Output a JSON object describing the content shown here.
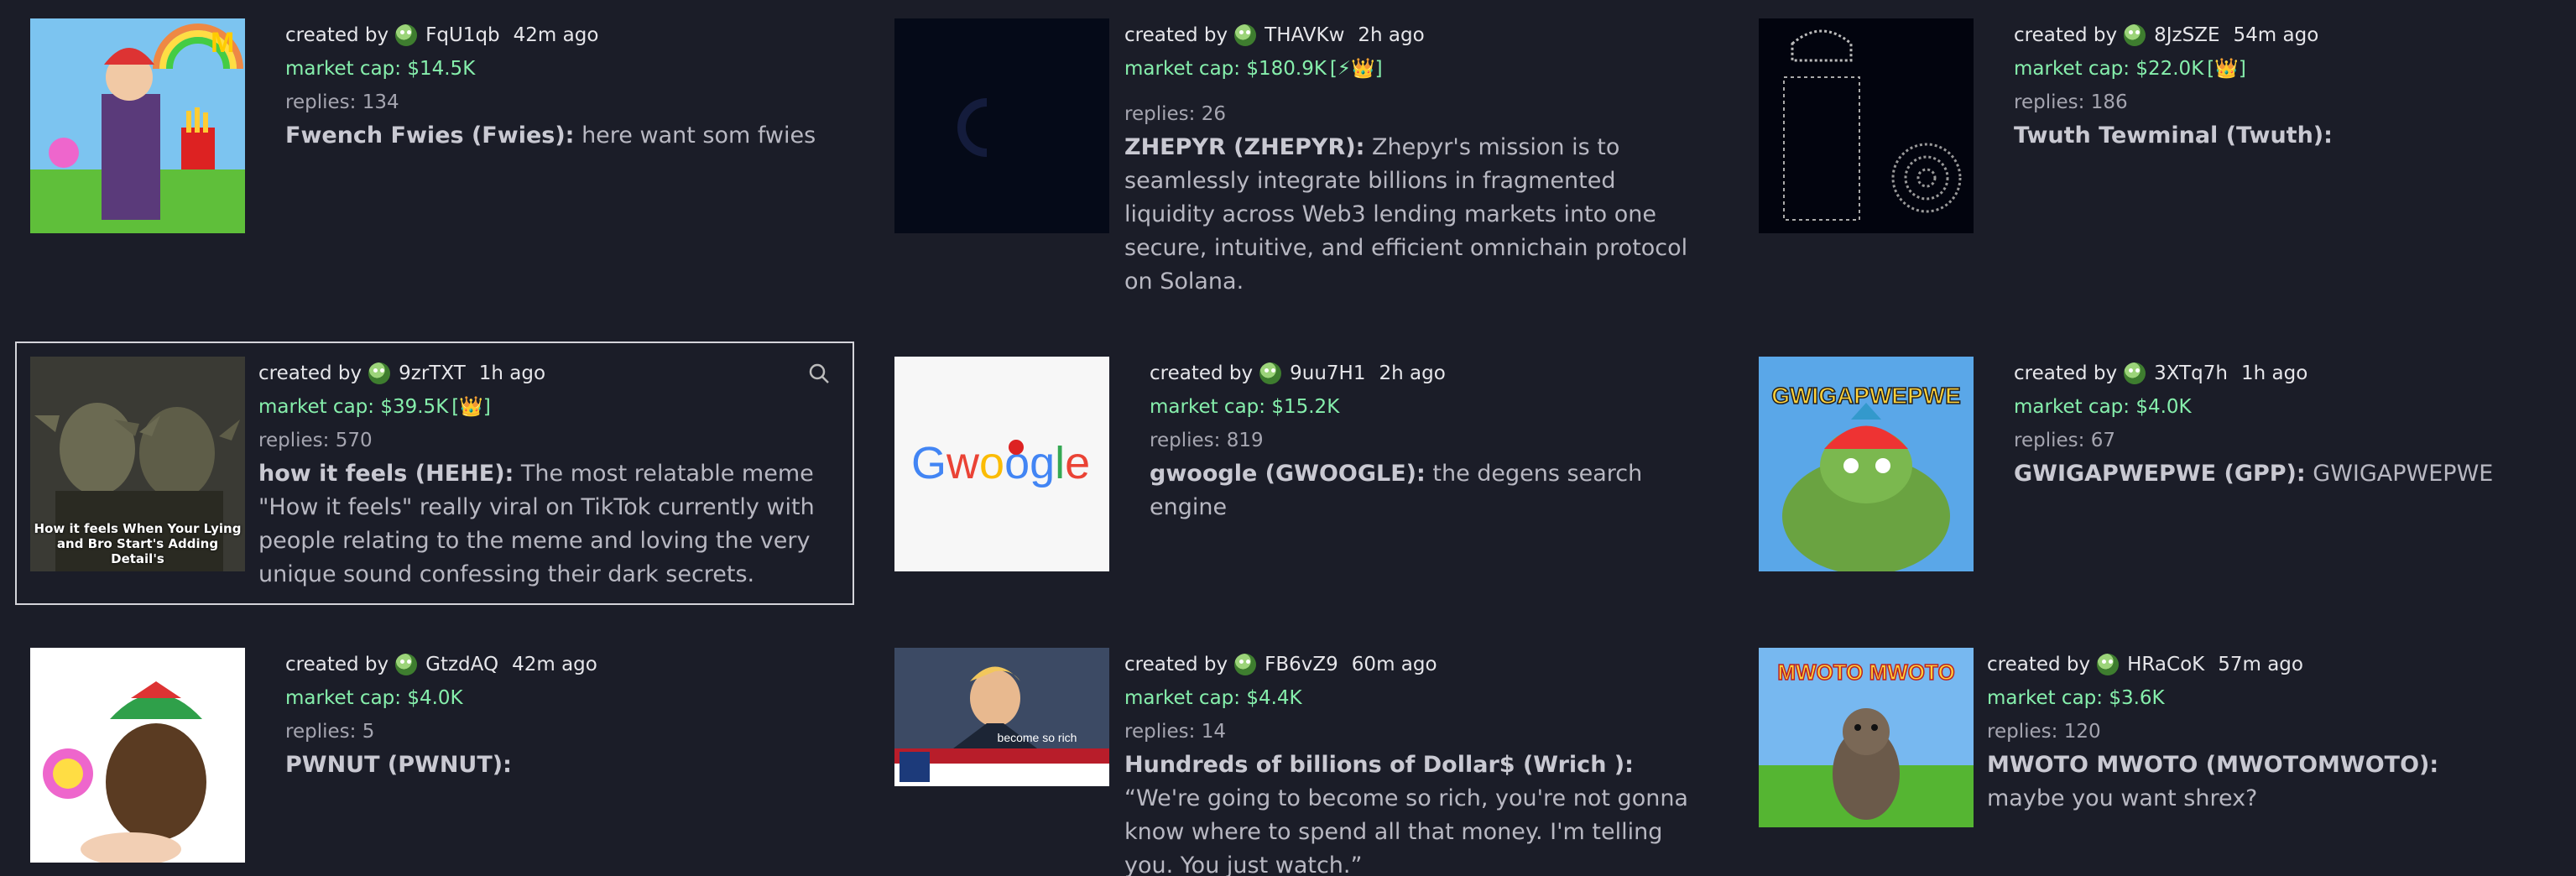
{
  "created_by_label": "created by",
  "market_cap_label": "market cap:",
  "replies_label": "replies:",
  "cards": [
    {
      "user": "FqU1qb",
      "time": "42m ago",
      "mcap": "$14.5K",
      "badge": "",
      "replies": "134",
      "name": "Fwench Fwies (Fwies):",
      "desc": " here want som fwies",
      "image": "fries-character-icon"
    },
    {
      "user": "THAVKw",
      "time": "2h ago",
      "mcap": "$180.9K",
      "badge": "[⚡👑]",
      "replies": "26",
      "name": "ZHEPYR (ZHEPYR):",
      "desc": " Zhepyr's mission is to seamlessly integrate billions in fragmented liquidity across Web3 lending markets into one secure, intuitive, and efficient omnichain protocol on Solana.",
      "image": "dark-logo-icon"
    },
    {
      "user": "8JzSZE",
      "time": "54m ago",
      "mcap": "$22.0K",
      "badge": "[👑]",
      "replies": "186",
      "name": "Twuth Tewminal (Twuth):",
      "desc": "",
      "image": "ascii-art-icon"
    },
    {
      "user": "9zrTXT",
      "time": "1h ago",
      "mcap": "$39.5K",
      "badge": "[👑]",
      "replies": "570",
      "name": "how it feels (HEHE):",
      "desc": " The most relatable meme \"How it feels\" really viral on TikTok currently with people relating to the meme and loving the very unique sound confessing their dark secrets.",
      "image": "goblins-icon",
      "caption": "How it feels When Your Lying and Bro Start's Adding Detail's"
    },
    {
      "user": "9uu7H1",
      "time": "2h ago",
      "mcap": "$15.2K",
      "badge": "",
      "replies": "819",
      "name": "gwoogle (GWOOGLE):",
      "desc": " the degens search engine",
      "image": "gwoogle-logo-icon",
      "logo": [
        "G",
        "w",
        "o",
        "o",
        "g",
        "l",
        "e"
      ]
    },
    {
      "user": "3XTq7h",
      "time": "1h ago",
      "mcap": "$4.0K",
      "badge": "",
      "replies": "67",
      "name": "GWIGAPWEPWE (GPP):",
      "desc": " GWIGAPWEPWE",
      "image": "pepe-muscle-icon",
      "banner": "GWIGAPWEPWE"
    },
    {
      "user": "GtzdAQ",
      "time": "42m ago",
      "mcap": "$4.0K",
      "badge": "",
      "replies": "5",
      "name": "PWNUT (PWNUT):",
      "desc": "",
      "image": "otter-hat-icon"
    },
    {
      "user": "FB6vZ9",
      "time": "60m ago",
      "mcap": "$4.4K",
      "badge": "",
      "replies": "14",
      "name": "Hundreds of billions of Dollar$ (Wrich ):",
      "desc": " “We're going to become so rich, you're not gonna know where to spend all that money. I'm telling you. You just watch.”",
      "image": "news-broadcast-icon",
      "caption": "become so rich"
    },
    {
      "user": "HRaCoK",
      "time": "57m ago",
      "mcap": "$3.6K",
      "badge": "",
      "replies": "120",
      "name": "MWOTO MWOTO (MWOTOMWOTO):",
      "desc": " maybe you want shrex?",
      "image": "mwoto-seal-icon",
      "banner": "MWOTO MWOTO"
    }
  ]
}
